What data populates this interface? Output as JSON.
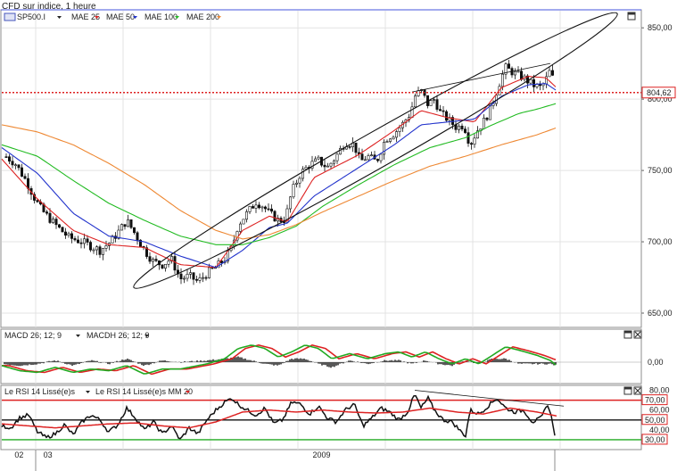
{
  "header": {
    "title": "CFD sur indice, 1 heure"
  },
  "price_panel": {
    "legend": {
      "instrument": "SP500.I",
      "items": [
        {
          "label": "MAE 25",
          "color": "#dd2222"
        },
        {
          "label": "MAE 50",
          "color": "#2233cc"
        },
        {
          "label": "MAE 100",
          "color": "#22bb22"
        },
        {
          "label": "MAE 200",
          "color": "#ee8833"
        }
      ]
    }
  },
  "macd_panel": {
    "legend": [
      {
        "label": "MACD 26; 12; 9"
      },
      {
        "label": "MACDH 26; 12; 9"
      }
    ]
  },
  "rsi_panel": {
    "legend": [
      {
        "label": "Le RSI 14 Lissé(e)s",
        "color": "#111111"
      },
      {
        "label": "Le RSI 14 Lissé(e)s MM 20",
        "color": "#dd2222"
      }
    ]
  },
  "x_axis": {
    "labels": [
      {
        "text": "02",
        "at": 0.02
      },
      {
        "text": "03",
        "at": 0.065
      },
      {
        "text": "2009",
        "at": 0.5
      }
    ]
  },
  "chart_data": [
    {
      "type": "line",
      "name_hint": "price",
      "ylim": [
        640,
        862
      ],
      "y_ticks": [
        {
          "label": "650,00",
          "value": 650
        },
        {
          "label": "700,00",
          "value": 700
        },
        {
          "label": "750,00",
          "value": 750
        },
        {
          "label": "800,00",
          "value": 800
        },
        {
          "label": "850,00",
          "value": 850
        }
      ],
      "last_price": {
        "label": "804,62",
        "value": 804.62,
        "color": "#dd2222"
      },
      "price_anchors": [
        [
          0,
          762
        ],
        [
          15,
          755
        ],
        [
          28,
          742
        ],
        [
          38,
          729
        ],
        [
          45,
          722
        ],
        [
          60,
          712
        ],
        [
          75,
          703
        ],
        [
          90,
          700
        ],
        [
          100,
          697
        ],
        [
          110,
          694
        ],
        [
          122,
          700
        ],
        [
          132,
          708
        ],
        [
          140,
          715
        ],
        [
          150,
          705
        ],
        [
          160,
          694
        ],
        [
          170,
          686
        ],
        [
          180,
          684
        ],
        [
          190,
          688
        ],
        [
          200,
          674
        ],
        [
          210,
          676
        ],
        [
          220,
          672
        ],
        [
          230,
          678
        ],
        [
          240,
          682
        ],
        [
          250,
          688
        ],
        [
          258,
          696
        ],
        [
          265,
          712
        ],
        [
          275,
          720
        ],
        [
          285,
          728
        ],
        [
          293,
          725
        ],
        [
          300,
          720
        ],
        [
          310,
          715
        ],
        [
          318,
          716
        ],
        [
          325,
          735
        ],
        [
          335,
          748
        ],
        [
          345,
          754
        ],
        [
          355,
          757
        ],
        [
          365,
          752
        ],
        [
          375,
          760
        ],
        [
          385,
          770
        ],
        [
          395,
          768
        ],
        [
          402,
          756
        ],
        [
          410,
          760
        ],
        [
          420,
          756
        ],
        [
          430,
          772
        ],
        [
          440,
          776
        ],
        [
          450,
          783
        ],
        [
          458,
          790
        ],
        [
          463,
          802
        ],
        [
          470,
          806
        ],
        [
          478,
          796
        ],
        [
          485,
          800
        ],
        [
          492,
          790
        ],
        [
          500,
          786
        ],
        [
          510,
          780
        ],
        [
          518,
          782
        ],
        [
          525,
          768
        ],
        [
          533,
          778
        ],
        [
          540,
          784
        ],
        [
          548,
          793
        ],
        [
          555,
          806
        ],
        [
          560,
          815
        ],
        [
          565,
          822
        ],
        [
          575,
          818
        ],
        [
          585,
          815
        ],
        [
          595,
          810
        ],
        [
          605,
          808
        ],
        [
          612,
          816
        ],
        [
          616,
          822
        ],
        [
          619,
          808
        ],
        [
          622,
          792
        ]
      ],
      "ma_anchors": {
        "MAE 25": [
          [
            0,
            758
          ],
          [
            40,
            730
          ],
          [
            80,
            708
          ],
          [
            120,
            698
          ],
          [
            160,
            696
          ],
          [
            200,
            684
          ],
          [
            240,
            682
          ],
          [
            270,
            708
          ],
          [
            300,
            718
          ],
          [
            320,
            714
          ],
          [
            350,
            745
          ],
          [
            400,
            761
          ],
          [
            440,
            778
          ],
          [
            470,
            792
          ],
          [
            500,
            787
          ],
          [
            530,
            784
          ],
          [
            560,
            808
          ],
          [
            590,
            816
          ],
          [
            610,
            815
          ],
          [
            622,
            808
          ]
        ],
        "MAE 50": [
          [
            0,
            766
          ],
          [
            40,
            748
          ],
          [
            80,
            720
          ],
          [
            120,
            704
          ],
          [
            160,
            700
          ],
          [
            200,
            690
          ],
          [
            240,
            682
          ],
          [
            270,
            694
          ],
          [
            300,
            710
          ],
          [
            320,
            713
          ],
          [
            350,
            732
          ],
          [
            400,
            752
          ],
          [
            440,
            768
          ],
          [
            470,
            782
          ],
          [
            500,
            784
          ],
          [
            530,
            786
          ],
          [
            560,
            802
          ],
          [
            590,
            810
          ],
          [
            610,
            811
          ],
          [
            622,
            806
          ]
        ],
        "MAE 100": [
          [
            0,
            768
          ],
          [
            40,
            760
          ],
          [
            80,
            743
          ],
          [
            120,
            727
          ],
          [
            160,
            715
          ],
          [
            200,
            704
          ],
          [
            240,
            698
          ],
          [
            270,
            698
          ],
          [
            300,
            703
          ],
          [
            330,
            711
          ],
          [
            360,
            725
          ],
          [
            400,
            740
          ],
          [
            440,
            754
          ],
          [
            480,
            766
          ],
          [
            520,
            773
          ],
          [
            550,
            782
          ],
          [
            580,
            790
          ],
          [
            600,
            793
          ],
          [
            622,
            797
          ]
        ],
        "MAE 200": [
          [
            0,
            782
          ],
          [
            40,
            777
          ],
          [
            80,
            768
          ],
          [
            120,
            755
          ],
          [
            160,
            740
          ],
          [
            200,
            722
          ],
          [
            240,
            708
          ],
          [
            270,
            702
          ],
          [
            300,
            705
          ],
          [
            330,
            712
          ],
          [
            360,
            721
          ],
          [
            400,
            732
          ],
          [
            440,
            743
          ],
          [
            480,
            753
          ],
          [
            520,
            760
          ],
          [
            560,
            768
          ],
          [
            600,
            775
          ],
          [
            622,
            780
          ]
        ]
      },
      "candles": {
        "start": 5,
        "end": 620,
        "step": 3.5
      },
      "annotations": [
        {
          "type": "ellipse",
          "description": "ascending channel",
          "from": [
            148,
            668
          ],
          "to": [
            690,
            860
          ],
          "half_width": 20
        },
        {
          "type": "trendline",
          "from": [
            460,
            805
          ],
          "to": [
            615,
            825
          ]
        }
      ]
    },
    {
      "type": "line",
      "name_hint": "MACD",
      "ylim": [
        -12,
        12
      ],
      "y_ticks": [
        {
          "label": "0,00",
          "value": 0
        }
      ],
      "series_colors": {
        "macd": "#22aa22",
        "signal": "#dd2222",
        "histogram": "#111111"
      },
      "macd_anchors": [
        [
          0,
          -2
        ],
        [
          20,
          -5
        ],
        [
          40,
          -6
        ],
        [
          60,
          -3
        ],
        [
          80,
          -6
        ],
        [
          100,
          -4
        ],
        [
          120,
          -5
        ],
        [
          140,
          -2
        ],
        [
          160,
          -7
        ],
        [
          180,
          -4
        ],
        [
          200,
          -4
        ],
        [
          230,
          -1
        ],
        [
          250,
          2
        ],
        [
          265,
          8
        ],
        [
          280,
          10
        ],
        [
          295,
          8
        ],
        [
          310,
          3
        ],
        [
          325,
          6
        ],
        [
          340,
          10
        ],
        [
          355,
          8
        ],
        [
          370,
          2
        ],
        [
          390,
          5
        ],
        [
          410,
          2
        ],
        [
          430,
          5
        ],
        [
          445,
          6
        ],
        [
          460,
          3
        ],
        [
          475,
          6
        ],
        [
          490,
          2
        ],
        [
          505,
          -1
        ],
        [
          520,
          2
        ],
        [
          535,
          -1
        ],
        [
          550,
          4
        ],
        [
          565,
          9
        ],
        [
          580,
          7
        ],
        [
          600,
          4
        ],
        [
          615,
          1
        ],
        [
          622,
          -2
        ]
      ],
      "histogram_anchors": [
        [
          0,
          -1
        ],
        [
          20,
          -2
        ],
        [
          40,
          -1
        ],
        [
          60,
          1
        ],
        [
          80,
          -2
        ],
        [
          100,
          1
        ],
        [
          120,
          -1
        ],
        [
          140,
          2
        ],
        [
          160,
          -2
        ],
        [
          180,
          1
        ],
        [
          200,
          0
        ],
        [
          230,
          1
        ],
        [
          250,
          2
        ],
        [
          265,
          3
        ],
        [
          280,
          1
        ],
        [
          295,
          -1
        ],
        [
          310,
          -2
        ],
        [
          325,
          2
        ],
        [
          340,
          2
        ],
        [
          355,
          -1
        ],
        [
          370,
          -3
        ],
        [
          390,
          1
        ],
        [
          410,
          -1
        ],
        [
          430,
          1
        ],
        [
          445,
          1
        ],
        [
          460,
          -1
        ],
        [
          475,
          1
        ],
        [
          490,
          -1
        ],
        [
          505,
          -2
        ],
        [
          520,
          1
        ],
        [
          535,
          -1
        ],
        [
          550,
          2
        ],
        [
          565,
          2
        ],
        [
          580,
          -1
        ],
        [
          600,
          -1
        ],
        [
          615,
          -1
        ],
        [
          622,
          -2
        ]
      ]
    },
    {
      "type": "line",
      "name_hint": "RSI",
      "ylim": [
        20,
        85
      ],
      "y_ticks": [
        {
          "label": "80,00",
          "value": 80
        },
        {
          "label": "60,00",
          "value": 60
        },
        {
          "label": "40,00",
          "value": 40
        }
      ],
      "levels": [
        {
          "label": "70,00",
          "value": 70,
          "color": "#dd2222",
          "boxed": true
        },
        {
          "label": "50,00",
          "value": 50,
          "color": "#dd2222",
          "boxed": true
        },
        {
          "label": "30,00",
          "value": 30,
          "color": "#dd2222",
          "boxed": true
        }
      ],
      "level_line_colors": {
        "70": "#dd2222",
        "50": "#111111",
        "30": "#22aa22"
      },
      "rsi_anchors": [
        [
          0,
          44
        ],
        [
          10,
          42
        ],
        [
          20,
          52
        ],
        [
          30,
          55
        ],
        [
          40,
          38
        ],
        [
          50,
          32
        ],
        [
          60,
          36
        ],
        [
          70,
          45
        ],
        [
          80,
          35
        ],
        [
          90,
          48
        ],
        [
          100,
          55
        ],
        [
          110,
          50
        ],
        [
          120,
          38
        ],
        [
          130,
          45
        ],
        [
          140,
          62
        ],
        [
          150,
          52
        ],
        [
          160,
          40
        ],
        [
          170,
          48
        ],
        [
          180,
          36
        ],
        [
          190,
          44
        ],
        [
          200,
          30
        ],
        [
          210,
          42
        ],
        [
          220,
          36
        ],
        [
          230,
          50
        ],
        [
          240,
          60
        ],
        [
          250,
          68
        ],
        [
          258,
          72
        ],
        [
          265,
          66
        ],
        [
          275,
          60
        ],
        [
          285,
          55
        ],
        [
          295,
          62
        ],
        [
          305,
          46
        ],
        [
          315,
          50
        ],
        [
          325,
          68
        ],
        [
          335,
          66
        ],
        [
          345,
          56
        ],
        [
          355,
          64
        ],
        [
          365,
          52
        ],
        [
          375,
          48
        ],
        [
          385,
          60
        ],
        [
          395,
          66
        ],
        [
          405,
          44
        ],
        [
          415,
          52
        ],
        [
          425,
          62
        ],
        [
          435,
          58
        ],
        [
          445,
          50
        ],
        [
          455,
          58
        ],
        [
          463,
          76
        ],
        [
          470,
          62
        ],
        [
          478,
          72
        ],
        [
          485,
          60
        ],
        [
          495,
          50
        ],
        [
          505,
          48
        ],
        [
          515,
          38
        ],
        [
          520,
          34
        ],
        [
          525,
          60
        ],
        [
          535,
          56
        ],
        [
          545,
          64
        ],
        [
          555,
          72
        ],
        [
          565,
          62
        ],
        [
          575,
          58
        ],
        [
          585,
          60
        ],
        [
          595,
          48
        ],
        [
          605,
          52
        ],
        [
          612,
          66
        ],
        [
          617,
          50
        ],
        [
          620,
          36
        ]
      ],
      "rsi_ma_anchors": [
        [
          0,
          46
        ],
        [
          30,
          44
        ],
        [
          60,
          42
        ],
        [
          90,
          44
        ],
        [
          120,
          46
        ],
        [
          150,
          47
        ],
        [
          180,
          44
        ],
        [
          210,
          42
        ],
        [
          240,
          48
        ],
        [
          270,
          58
        ],
        [
          300,
          60
        ],
        [
          330,
          58
        ],
        [
          360,
          60
        ],
        [
          390,
          58
        ],
        [
          420,
          57
        ],
        [
          450,
          58
        ],
        [
          480,
          62
        ],
        [
          510,
          58
        ],
        [
          540,
          56
        ],
        [
          570,
          62
        ],
        [
          600,
          58
        ],
        [
          622,
          54
        ]
      ],
      "annotations": [
        {
          "type": "trendline",
          "from": [
            463,
            80
          ],
          "to": [
            630,
            64
          ]
        }
      ]
    }
  ]
}
